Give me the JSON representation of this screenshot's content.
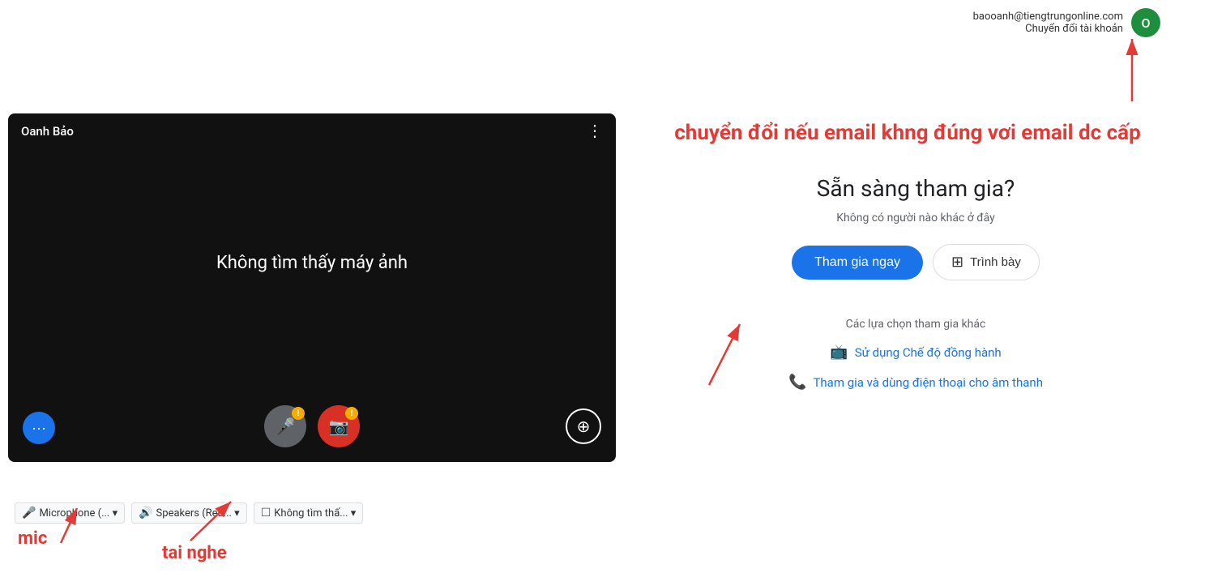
{
  "header": {
    "email": "baooanh@tiengtrungonline.com",
    "switch_account": "Chuyển đổi tài khoản",
    "avatar_letter": "O"
  },
  "video": {
    "user_name": "Oanh Bảo",
    "no_camera_text": "Không tìm thấy máy ảnh",
    "more_options_label": "⋮"
  },
  "controls": {
    "mic_warning": "!",
    "camera_warning": "!",
    "more_label": "•••"
  },
  "devices": {
    "mic_label": "Microphone (... ▾",
    "speaker_label": "Speakers (Rea... ▾",
    "camera_label": "Không tìm thấ... ▾"
  },
  "right_panel": {
    "annotation": "chuyển đổi nếu email khng đúng vơi email dc cấp",
    "ready_title": "Sẵn sàng tham gia?",
    "no_one": "Không có người nào khác ở đây",
    "join_now": "Tham gia ngay",
    "present": "Trình bày",
    "other_options": "Các lựa chọn tham gia khác",
    "companion_mode": "Sử dụng Chế độ đồng hành",
    "phone_audio": "Tham gia và dùng điện thoại cho âm thanh"
  },
  "annotations": {
    "mic": "mic",
    "speaker": "tai nghe"
  }
}
